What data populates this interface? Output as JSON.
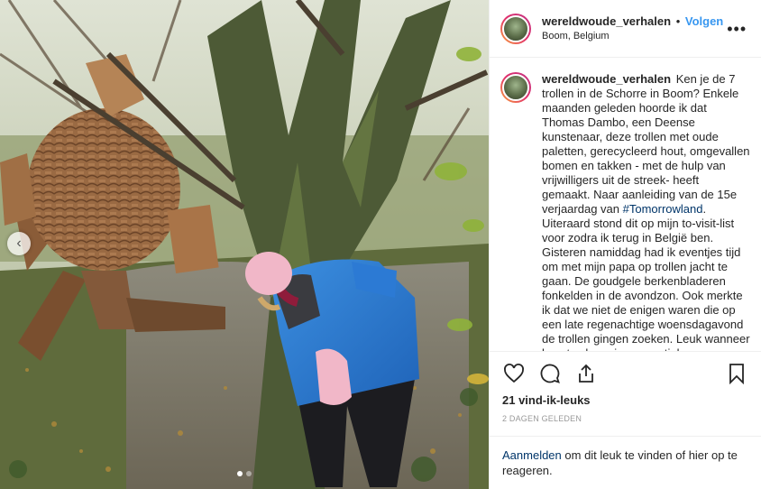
{
  "post": {
    "username": "wereldwoude_verhalen",
    "separator": "•",
    "follow_label": "Volgen",
    "location": "Boom, Belgium",
    "more_label": "•••",
    "caption_user": "wereldwoude_verhalen",
    "caption_part1": "Ken je de 7 trollen in de Schorre in Boom? Enkele maanden geleden hoorde ik dat Thomas Dambo, een Deense kunstenaar, deze trollen met oude paletten, gerecycleerd hout, omgevallen bomen en takken - met de hulp van vrijwilligers uit de streek- heeft gemaakt. Naar aanleiding van de 15e verjaardag van ",
    "hashtag": "#Tomorrowland",
    "caption_part2": ". Uiteraard stond dit op mijn to-visit-list voor zodra ik terug in België ben. Gisteren namiddag had ik eventjes tijd om met mijn papa op trollen jacht te gaan. De goudgele berkenbladeren fonkelden in de avondzon. Ook merkte ik dat we niet de enigen waren die op een late regenachtige woensdagavond de trollen gingen zoeken. Leuk wanneer kunst vol magie en mystiek mensen naar de",
    "likes": "21 vind-ik-leuks",
    "time": "2 DAGEN GELEDEN",
    "login_link": "Aanmelden",
    "login_rest": " om dit leuk te vinden of hier op te reageren."
  },
  "carousel": {
    "prev_label": "‹",
    "slide_count": 2,
    "active_index": 0
  },
  "icons": [
    "heart-icon",
    "comment-icon",
    "share-icon",
    "bookmark-icon",
    "chevron-left-icon",
    "more-icon"
  ],
  "colors": {
    "accent": "#3897f0",
    "link": "#003569",
    "muted": "#999999",
    "text": "#262626"
  }
}
